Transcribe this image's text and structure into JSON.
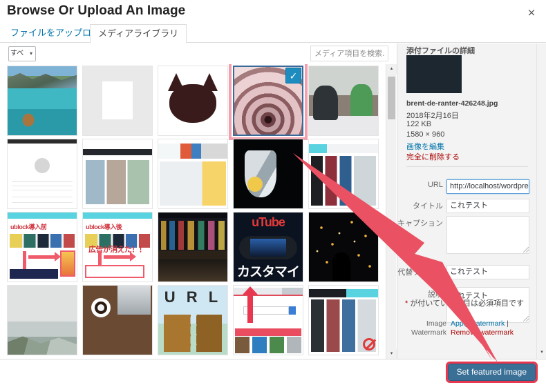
{
  "modal": {
    "title": "Browse Or Upload An Image",
    "close_label": "×"
  },
  "tabs": [
    {
      "label": "ファイルをアップロード",
      "active": false
    },
    {
      "label": "メディアライブラリ",
      "active": true
    }
  ],
  "toolbar": {
    "filter_value": "すべ",
    "filter_caret": "▾",
    "search_placeholder": "メディア項目を検索...",
    "search_value": ""
  },
  "grid": {
    "checkmark": "✓",
    "items": [
      {
        "name": "lake-boat-mountains",
        "art": "art-lake",
        "selected": false
      },
      {
        "name": "black-cat-small",
        "art": "art-cat-small",
        "selected": false
      },
      {
        "name": "black-cat-large",
        "art": "art-cat-big",
        "selected": false
      },
      {
        "name": "pink-spiral-staircase",
        "art": "art-spiral",
        "selected": true
      },
      {
        "name": "kids-cheering-laptop",
        "art": "art-kids",
        "selected": false
      },
      {
        "name": "blank-document-screenshot",
        "art": "art-doc",
        "selected": false
      },
      {
        "name": "blog-listing-screenshot",
        "art": "art-blog",
        "selected": false
      },
      {
        "name": "dora-site-screenshot",
        "art": "art-dora",
        "selected": false
      },
      {
        "name": "cocktail-glass-lemon",
        "art": "art-glass",
        "selected": false
      },
      {
        "name": "website-screenshot-teal",
        "art": "art-site",
        "selected": false
      },
      {
        "name": "ublock-before-screenshot",
        "art": "art-ublock-before",
        "selected": false
      },
      {
        "name": "ublock-after-screenshot",
        "art": "art-ublock-after",
        "selected": false
      },
      {
        "name": "night-city-billboards",
        "art": "art-city",
        "selected": false
      },
      {
        "name": "youtube-customize-thumbnail",
        "art": "art-youtube",
        "selected": false
      },
      {
        "name": "lantern-festival-night",
        "art": "art-lantern",
        "selected": false
      },
      {
        "name": "foggy-lake-landscape",
        "art": "art-fog",
        "selected": false
      },
      {
        "name": "desk-coffee-notebook",
        "art": "art-desk",
        "selected": false
      },
      {
        "name": "url-wooden-signs",
        "art": "art-url",
        "selected": false
      },
      {
        "name": "search-page-screenshot",
        "art": "art-search",
        "selected": false
      },
      {
        "name": "website-screenshot-dark",
        "art": "art-site2",
        "selected": false
      }
    ],
    "ublock_before_title": "ublock導入前",
    "ublock_after_title": "ublock導入後",
    "ublock_after_note": "広告が消えた！！",
    "youtube_top_text": "uTube",
    "youtube_bottom_text": "カスタマイ",
    "url_text": "U R L"
  },
  "sidebar": {
    "heading": "添付ファイルの詳細",
    "filename": "brent-de-ranter-426248.jpg",
    "date": "2018年2月16日",
    "filesize": "122 KB",
    "dimensions": "1580 × 960",
    "edit_image_link": "画像を編集",
    "delete_permanently_link": "完全に削除する",
    "fields": [
      {
        "label": "URL",
        "value": "http://localhost/wordpress/",
        "type": "input",
        "focused": true
      },
      {
        "label": "タイトル",
        "value": "これテスト",
        "type": "input",
        "focused": false
      },
      {
        "label": "キャプション",
        "value": "",
        "type": "textarea",
        "focused": false
      },
      {
        "label": "代替テキスト",
        "value": "これテスト",
        "type": "input",
        "focused": false
      },
      {
        "label": "説明",
        "value": "これテスト",
        "type": "textarea",
        "focused": false
      }
    ],
    "required_note_star": "*",
    "required_note": " が付いている項目は必須項目です",
    "watermark_label": "Image Watermark",
    "watermark_apply": "Apply watermark",
    "watermark_separator": " | ",
    "watermark_remove": "Remove watermark",
    "scroll_down_arrow": "▾"
  },
  "grid_scrollbar": {
    "up_arrow": "▴",
    "down_arrow": "▾"
  },
  "footer": {
    "set_featured_image_label": "Set featured image"
  },
  "colors": {
    "accent_blue": "#0073aa",
    "button_blue": "#3a6f96",
    "highlight_red": "#e8384f",
    "selection_pink": "#f2a0ae",
    "delete_red": "#a00",
    "arrow_red": "#ea5264"
  }
}
